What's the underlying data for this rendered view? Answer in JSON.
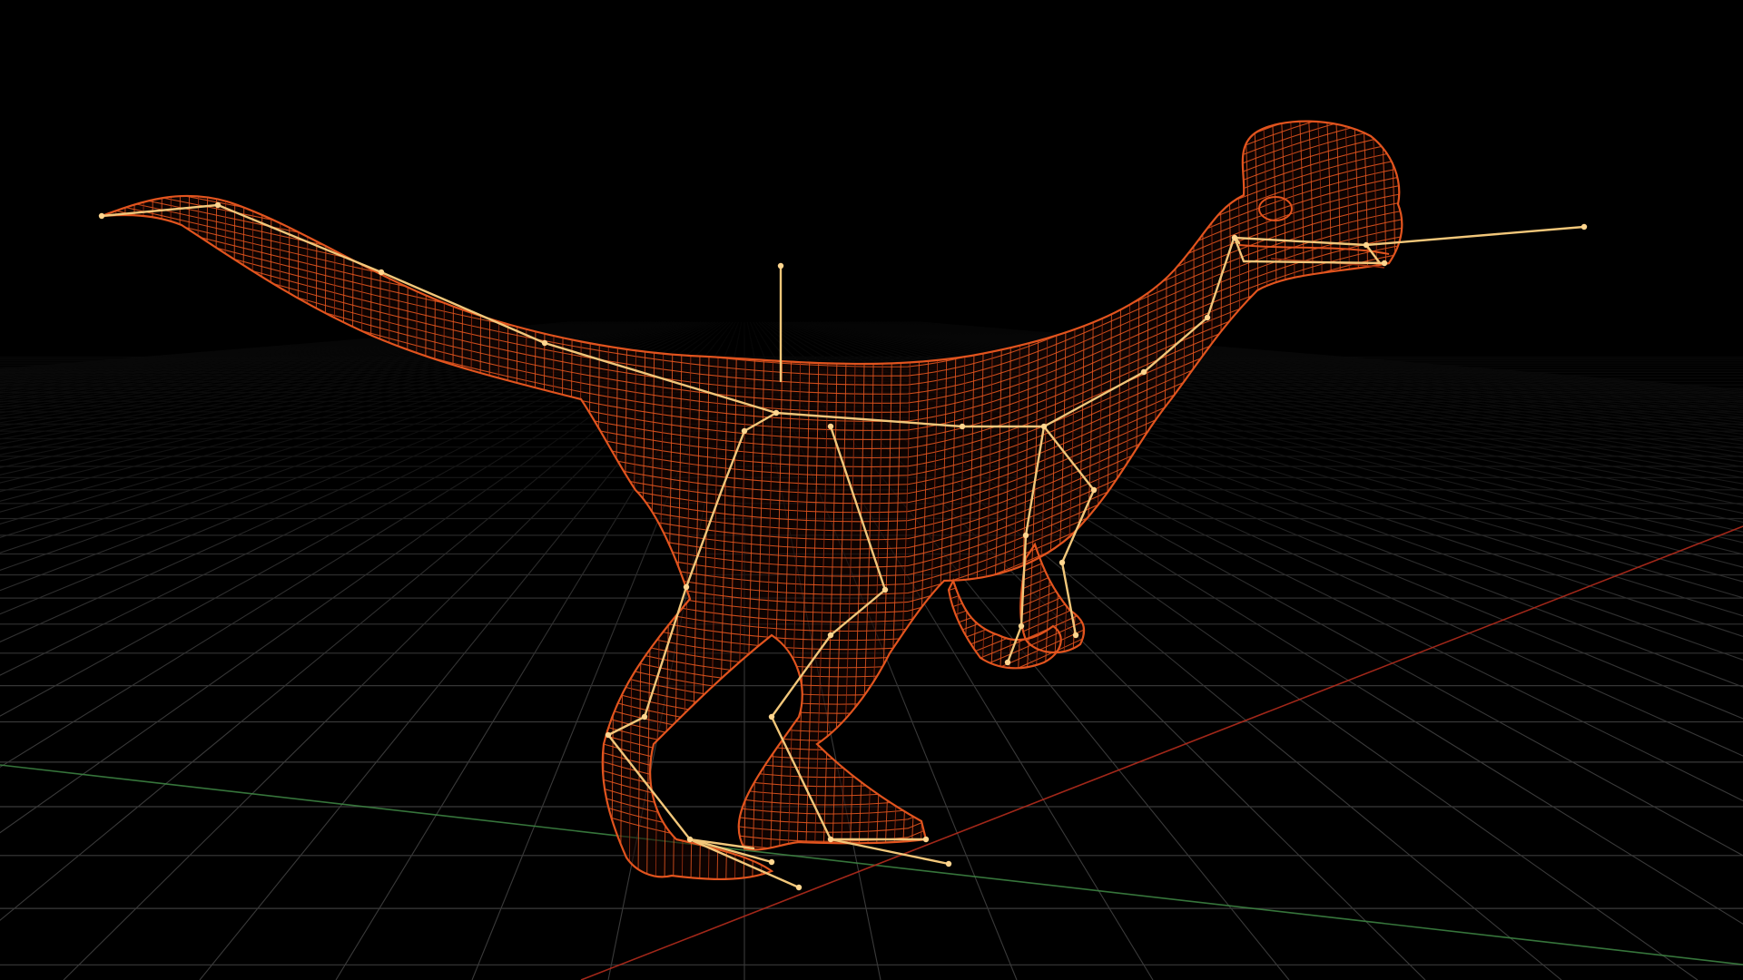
{
  "viewport": {
    "name": "3d-viewport",
    "view_mode": "wireframe",
    "background_color": "#000000"
  },
  "scene": {
    "grid": {
      "visible": true,
      "line_color": "#3a3a3a",
      "x_axis_color": "#b32b1c",
      "z_axis_color": "#3f8a45"
    },
    "model": {
      "type": "dinosaur-mesh",
      "display": "wireframe",
      "wire_color": "#e2541e",
      "wire_dark_color": "#9a2e10"
    },
    "skeleton": {
      "visible": true,
      "bone_color": "#f2c77a",
      "joint_color": "#ffd68f"
    }
  }
}
